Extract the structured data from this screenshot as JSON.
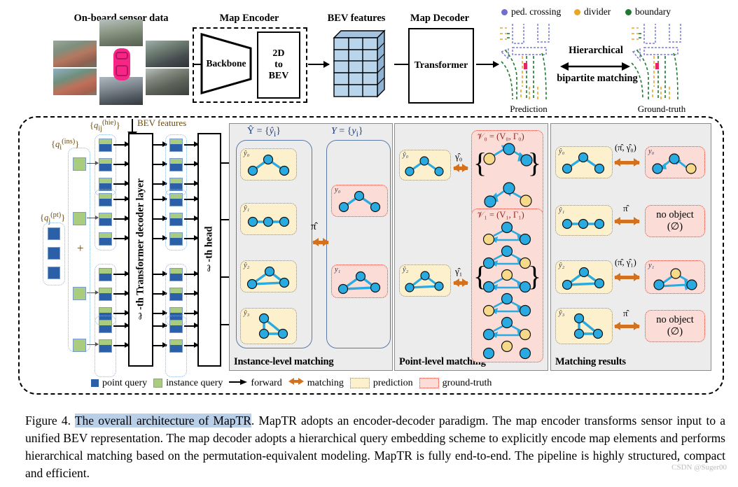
{
  "figure": {
    "number": "Figure 4.",
    "highlight": "The overall architecture of MapTR",
    "caption_rest": ". MapTR adopts an encoder-decoder paradigm. The map encoder transforms sensor input to a unified BEV representation. The map decoder adopts a hierarchical query embedding scheme to explicitly encode map elements and performs hierarchical matching based on the permutation-equivalent modeling. MapTR is fully end-to-end. The pipeline is highly structured, compact and efficient.",
    "watermark": "CSDN @Suger00"
  },
  "pipeline": {
    "sensor_title": "On-board sensor data",
    "map_encoder_title": "Map Encoder",
    "backbone_label": "Backbone",
    "twod_to_bev_label": "2D\nto\nBEV",
    "bev_features_title": "BEV features",
    "map_decoder_title": "Map Decoder",
    "transformer_label": "Transformer",
    "hierarchical_label": "Hierarchical",
    "bipartite_label": "bipartite matching",
    "prediction_caption": "Prediction",
    "groundtruth_caption": "Ground-truth"
  },
  "map_legend": [
    {
      "label": "ped. crossing",
      "color": "#6f6fd0"
    },
    {
      "label": "divider",
      "color": "#e9a62a"
    },
    {
      "label": "boundary",
      "color": "#1e7a2e"
    }
  ],
  "decoder": {
    "bev_features_label": "BEV features",
    "q_ins": "{q_i^(ins)}",
    "q_hie": "{q_ij^(hie)}",
    "q_pt": "{q_j^(pt)}",
    "plus": "+",
    "transformer_layer_label": "ℓ-th Transformer decoder layer",
    "head_label": "ℓ-th head"
  },
  "panels": {
    "instance": {
      "title": "Instance-level matching",
      "pred_header": "Ŷ = {ŷᵢ}",
      "gt_header": "Y = {yᵢ}",
      "match_label": "π̂",
      "pred_items": [
        "ŷ₀",
        "ŷ₁",
        "ŷ₂",
        "ŷ₃"
      ],
      "gt_items": [
        "y₀",
        "y₁"
      ]
    },
    "point": {
      "title": "Point-level matching",
      "pred_items": [
        "ŷ₀",
        "ŷ₂"
      ],
      "match_labels": [
        "γ̂₀",
        "γ̂₁"
      ],
      "set_headers": [
        "𝒱₀ = (V₀, Γ₀)",
        "𝒱₁ = (V₁, Γ₁)"
      ]
    },
    "results": {
      "title": "Matching results",
      "rows": [
        {
          "pred": "ŷ₀",
          "label": "(π̂, γ̂₀)",
          "gt": "y₀",
          "gt_type": "graph"
        },
        {
          "pred": "ŷ₁",
          "label": "π̂",
          "gt": "no object",
          "gt_sub": "(∅)",
          "gt_type": "none"
        },
        {
          "pred": "ŷ₂",
          "label": "(π̂, γ̂₁)",
          "gt": "y₁",
          "gt_type": "graph"
        },
        {
          "pred": "ŷ₃",
          "label": "π̂",
          "gt": "no object",
          "gt_sub": "(∅)",
          "gt_type": "none"
        }
      ]
    }
  },
  "figure_legend": [
    {
      "label": "point query",
      "kind": "square",
      "color": "#2b5fa8"
    },
    {
      "label": "instance query",
      "kind": "square",
      "color": "#a9cc7e"
    },
    {
      "label": "forward",
      "kind": "arrow",
      "color": "#000000"
    },
    {
      "label": "matching",
      "kind": "biarrow",
      "color": "#d4711e"
    },
    {
      "label": "prediction",
      "kind": "swatch",
      "color": "#fdf1cd"
    },
    {
      "label": "ground-truth",
      "kind": "swatch",
      "color": "#fbdcd6"
    }
  ],
  "colors": {
    "node": "#29abe2",
    "node_alt": "#f7d98a",
    "prediction_bg": "#fdf1cd",
    "groundtruth_bg": "#fbdcd6",
    "match_orange": "#d4711e",
    "bev_cell": "#b9d5ec",
    "point_query": "#2b5fa8",
    "instance_query": "#a9cc7e"
  }
}
